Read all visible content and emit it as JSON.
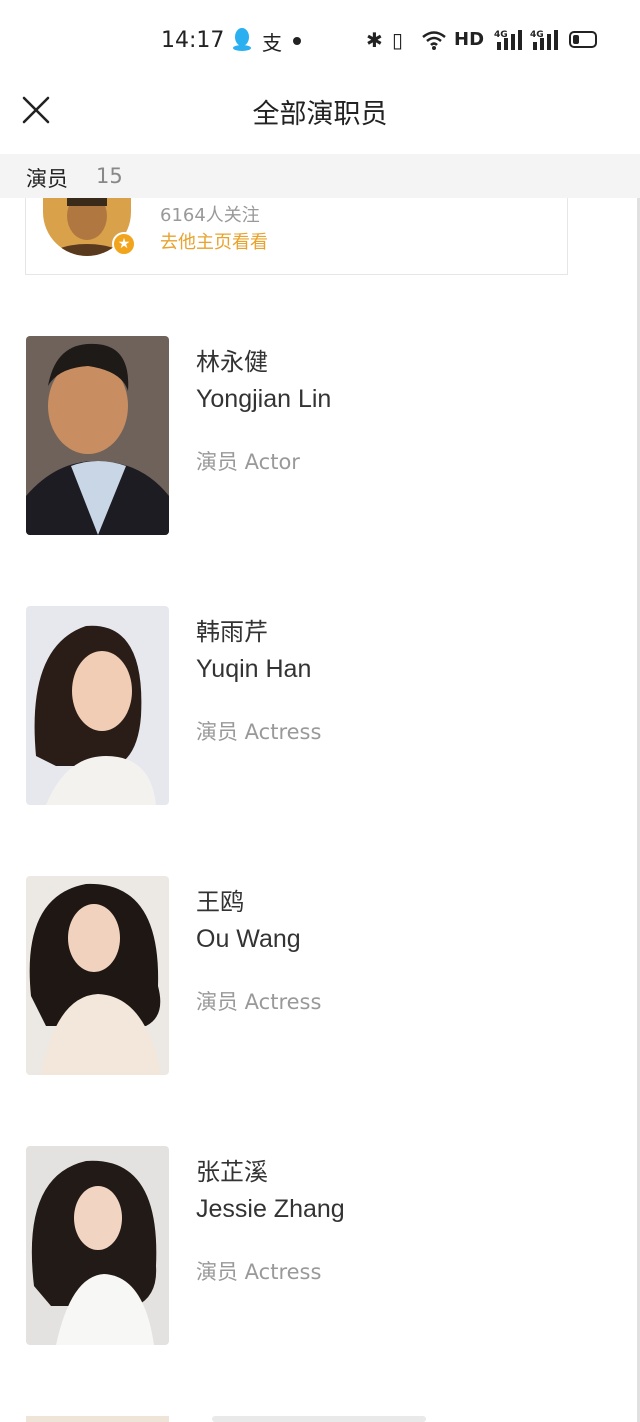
{
  "status_bar": {
    "time": "14:17",
    "network_label": "HD",
    "network_type": "4G",
    "icons": [
      "qq-icon",
      "alipay-icon",
      "notification-dot-icon",
      "bluetooth-icon",
      "vibrate-icon",
      "wifi-icon",
      "signal-icon",
      "battery-icon"
    ],
    "pay_glyph": "支"
  },
  "header": {
    "title": "全部演职员",
    "close_icon": "close-icon"
  },
  "section": {
    "label": "演员",
    "count": "15"
  },
  "featured": {
    "followers": "6164人关注",
    "link": "去他主页看看",
    "badge_icon": "star-badge-icon"
  },
  "cast": [
    {
      "name_cn": "林永健",
      "name_en": "Yongjian Lin",
      "role": "演员 Actor"
    },
    {
      "name_cn": "韩雨芹",
      "name_en": "Yuqin Han",
      "role": "演员 Actress"
    },
    {
      "name_cn": "王鸥",
      "name_en": "Ou Wang",
      "role": "演员 Actress"
    },
    {
      "name_cn": "张芷溪",
      "name_en": "Jessie Zhang",
      "role": "演员 Actress"
    }
  ],
  "colors": {
    "accent": "#e8a32e",
    "badge": "#f2a41c",
    "section_bg": "#f4f4f4",
    "muted_text": "#999999"
  }
}
